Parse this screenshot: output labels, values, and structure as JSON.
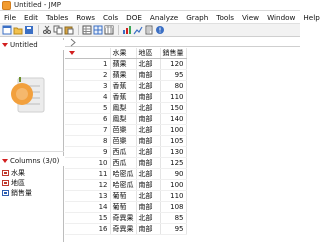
{
  "window": {
    "title": "Untitled - JMP"
  },
  "menu": [
    "File",
    "Edit",
    "Tables",
    "Rows",
    "Cols",
    "DOE",
    "Analyze",
    "Graph",
    "Tools",
    "View",
    "Window",
    "Help"
  ],
  "left_panel": {
    "table_name": "Untitled",
    "columns_header": "Columns (3/0)",
    "columns": [
      "水果",
      "地區",
      "銷售量"
    ]
  },
  "grid": {
    "headers": [
      "水果",
      "地區",
      "銷售量"
    ],
    "rows": [
      [
        "1",
        "蘋果",
        "北部",
        "120"
      ],
      [
        "2",
        "蘋果",
        "南部",
        "95"
      ],
      [
        "3",
        "香蕉",
        "北部",
        "80"
      ],
      [
        "4",
        "香蕉",
        "南部",
        "110"
      ],
      [
        "5",
        "鳳梨",
        "北部",
        "150"
      ],
      [
        "6",
        "鳳梨",
        "南部",
        "140"
      ],
      [
        "7",
        "芭樂",
        "北部",
        "100"
      ],
      [
        "8",
        "芭樂",
        "南部",
        "105"
      ],
      [
        "9",
        "西瓜",
        "北部",
        "130"
      ],
      [
        "10",
        "西瓜",
        "南部",
        "125"
      ],
      [
        "11",
        "哈密瓜",
        "北部",
        "90"
      ],
      [
        "12",
        "哈密瓜",
        "南部",
        "100"
      ],
      [
        "13",
        "葡萄",
        "北部",
        "110"
      ],
      [
        "14",
        "葡萄",
        "南部",
        "108"
      ],
      [
        "15",
        "奇異果",
        "北部",
        "85"
      ],
      [
        "16",
        "奇異果",
        "南部",
        "95"
      ]
    ]
  },
  "colors": {
    "accent": "#d21f1f",
    "logo": "#f29b2f"
  }
}
